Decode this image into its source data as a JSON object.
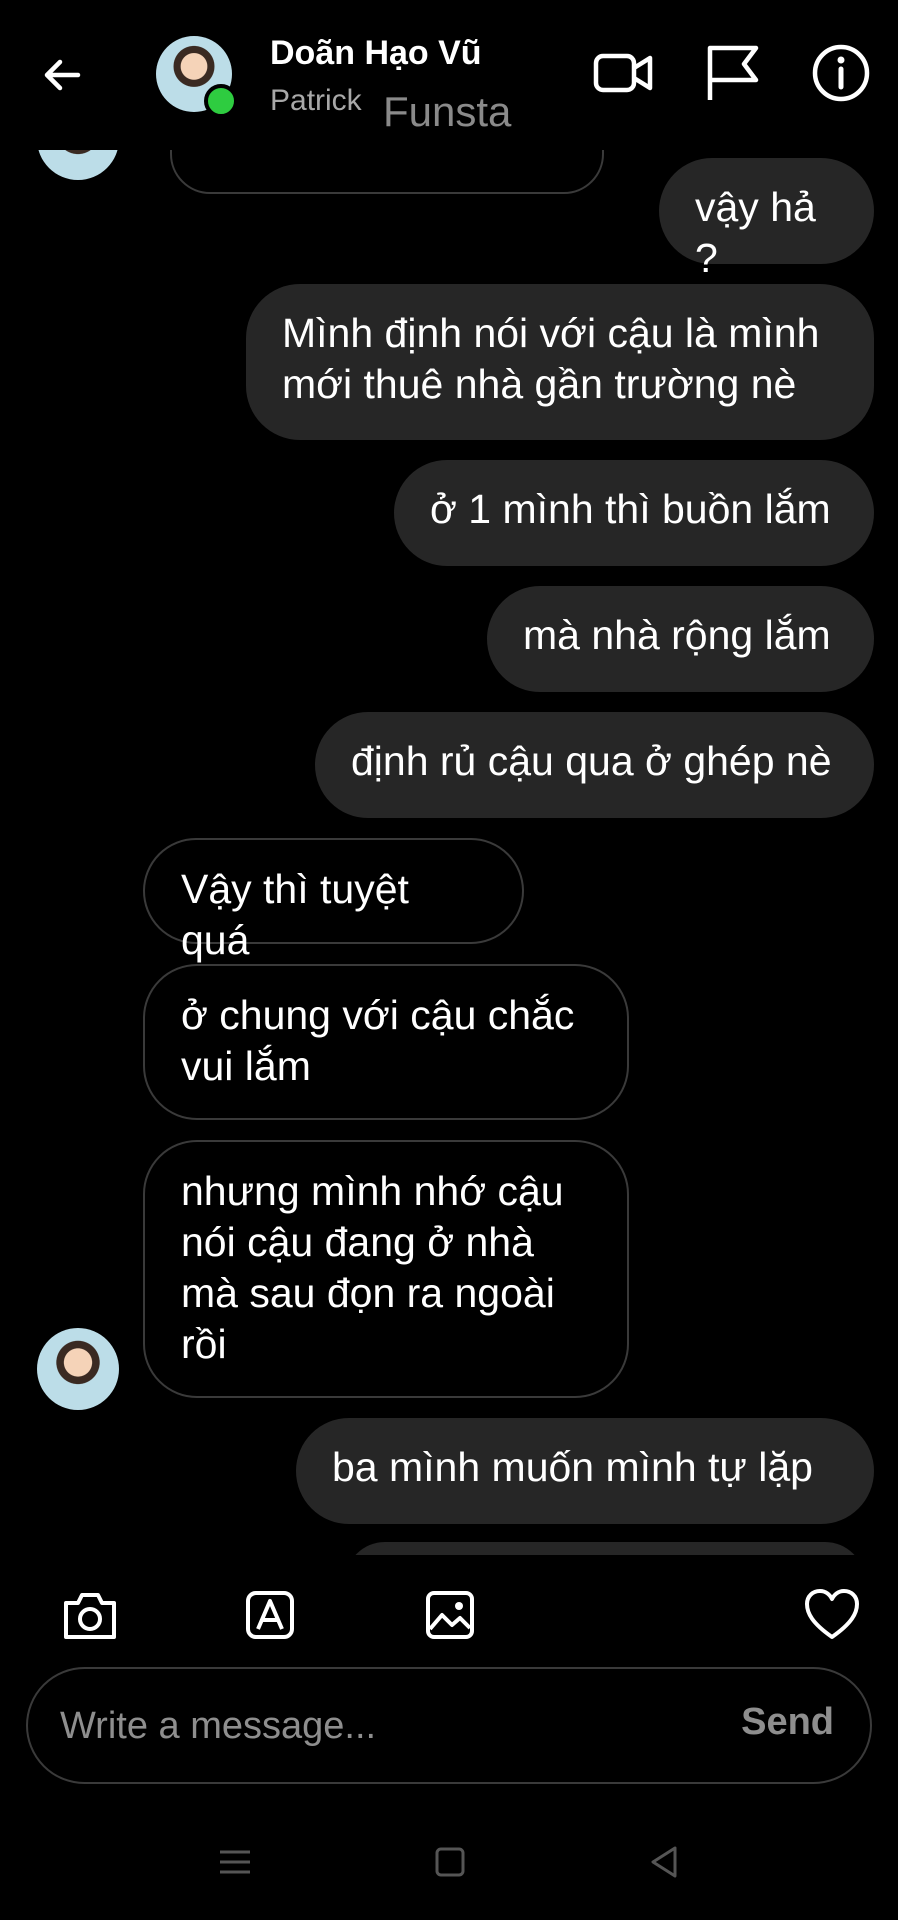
{
  "header": {
    "name": "Doãn Hạo Vũ",
    "username": "Patrick",
    "tag": "Funsta"
  },
  "icons": {
    "back": "back-arrow-icon",
    "video": "video-call-icon",
    "flag": "flag-icon",
    "info": "info-icon",
    "camera": "camera-icon",
    "sticker": "sticker-icon",
    "gallery": "gallery-icon",
    "like": "heart-icon"
  },
  "messages": [
    {
      "side": "out",
      "text": "vậy hả ?"
    },
    {
      "side": "out",
      "text": "Mình định nói với cậu là mình\nmới thuê nhà gần trường nè"
    },
    {
      "side": "out",
      "text": "ở 1 mình thì buồn lắm"
    },
    {
      "side": "out",
      "text": "mà nhà rộng lắm"
    },
    {
      "side": "out",
      "text": "định rủ cậu qua ở ghép nè"
    },
    {
      "side": "in",
      "text": "Vậy thì tuyệt quá"
    },
    {
      "side": "in",
      "text": "ở chung với cậu chắc\nvui lắm"
    },
    {
      "side": "in",
      "text": "nhưng mình nhớ cậu\nnói cậu đang ở nhà\nmà sau đọn ra ngoài\nrồi"
    },
    {
      "side": "out",
      "text": "ba mình muốn mình tự lặp"
    }
  ],
  "composer": {
    "placeholder": "Write a message...",
    "send_label": "Send"
  },
  "colors": {
    "background": "#000000",
    "outgoing_bubble": "#262626",
    "incoming_border": "#3a3a3a",
    "online": "#2ecc40"
  }
}
